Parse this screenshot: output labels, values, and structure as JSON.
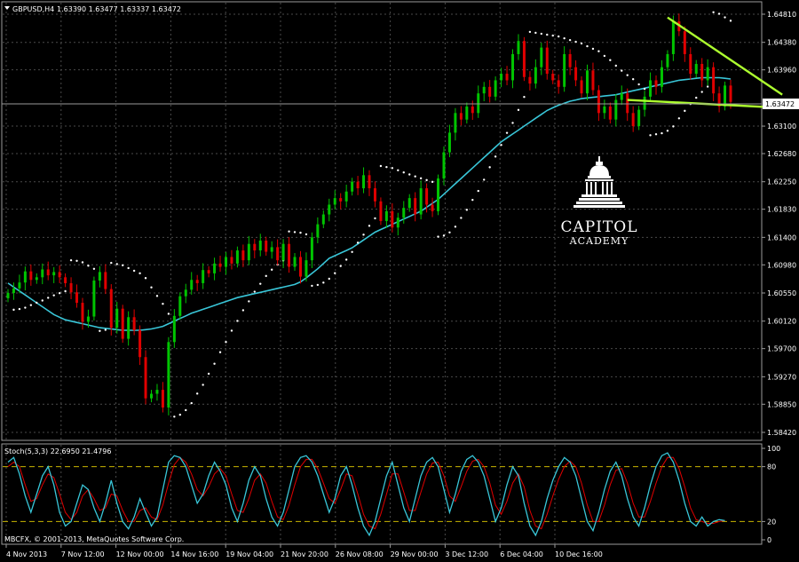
{
  "header": {
    "symbol_text": "GBPUSD,H4",
    "ohlc_text": "1.63390 1.63477 1.63337 1.63472"
  },
  "current_price_label": "1.63472",
  "stoch_label": "Stoch(5,3,3) 22.6950 21.4796",
  "copyright": "MBCFX, © 2001-2013, MetaQuotes Software Corp.",
  "logo": {
    "line1": "CAPITOL",
    "line2": "ACADEMY"
  },
  "colors": {
    "background": "#000000",
    "grid": "#4a4a4a",
    "bull": "#00c400",
    "bear": "#e00000",
    "ma": "#39c6d8",
    "sar": "#ffffff",
    "trendline": "#adff2f",
    "stoch_main": "#39c6d8",
    "stoch_signal": "#e00000",
    "stoch_level": "#c8b400"
  },
  "chart_data": [
    {
      "type": "candlestick",
      "symbol": "GBPUSD",
      "timeframe": "H4",
      "y_ticks": [
        "1.64810",
        "1.64380",
        "1.63960",
        "1.63100",
        "1.62680",
        "1.62250",
        "1.61830",
        "1.61400",
        "1.60980",
        "1.60550",
        "1.60120",
        "1.59700",
        "1.59270",
        "1.58850",
        "1.58420"
      ],
      "x_ticks": [
        "4 Nov 2013",
        "7 Nov 12:00",
        "12 Nov 00:00",
        "14 Nov 16:00",
        "19 Nov 04:00",
        "21 Nov 20:00",
        "26 Nov 08:00",
        "29 Nov 00:00",
        "3 Dec 12:00",
        "6 Dec 04:00",
        "10 Dec 16:00"
      ],
      "ylim": [
        1.5842,
        1.6481
      ],
      "last_price": 1.63472,
      "close": [
        1.6055,
        1.6062,
        1.6071,
        1.6088,
        1.6075,
        1.6079,
        1.6091,
        1.6082,
        1.6087,
        1.6079,
        1.607,
        1.6056,
        1.604,
        1.6011,
        1.6019,
        1.6074,
        1.6087,
        1.6061,
        1.6002,
        1.6031,
        1.5985,
        1.6018,
        1.5998,
        1.5957,
        1.5894,
        1.5901,
        1.5907,
        1.588,
        1.598,
        1.602,
        1.605,
        1.606,
        1.6075,
        1.607,
        1.609,
        1.6085,
        1.61,
        1.6095,
        1.611,
        1.61,
        1.612,
        1.6105,
        1.613,
        1.612,
        1.6135,
        1.6118,
        1.6125,
        1.6105,
        1.613,
        1.6095,
        1.611,
        1.608,
        1.6105,
        1.614,
        1.616,
        1.6175,
        1.619,
        1.62,
        1.6195,
        1.621,
        1.6225,
        1.6215,
        1.6235,
        1.6215,
        1.6195,
        1.6165,
        1.618,
        1.6155,
        1.617,
        1.6185,
        1.62,
        1.6175,
        1.6215,
        1.619,
        1.618,
        1.623,
        1.627,
        1.63,
        1.633,
        1.632,
        1.634,
        1.633,
        1.636,
        1.637,
        1.6355,
        1.638,
        1.639,
        1.638,
        1.642,
        1.644,
        1.6385,
        1.6375,
        1.64,
        1.643,
        1.639,
        1.638,
        1.637,
        1.642,
        1.64,
        1.638,
        1.636,
        1.6395,
        1.6365,
        1.633,
        1.634,
        1.632,
        1.635,
        1.636,
        1.633,
        1.631,
        1.6335,
        1.6355,
        1.638,
        1.637,
        1.64,
        1.642,
        1.647,
        1.6455,
        1.642,
        1.639,
        1.6405,
        1.638,
        1.64,
        1.636,
        1.634,
        1.6372,
        1.6347
      ],
      "sma": [
        1.607,
        1.6064,
        1.6058,
        1.6052,
        1.6046,
        1.604,
        1.6034,
        1.6028,
        1.6022,
        1.6018,
        1.6014,
        1.6012,
        1.601,
        1.6008,
        1.6006,
        1.6004,
        1.6002,
        1.6001,
        1.6,
        1.5999,
        1.5998,
        1.5998,
        1.5998,
        1.5998,
        1.5999,
        1.6,
        1.6002,
        1.6004,
        1.6008,
        1.6012,
        1.6016,
        1.602,
        1.6024,
        1.6027,
        1.603,
        1.6033,
        1.6036,
        1.6039,
        1.6042,
        1.6045,
        1.6048,
        1.605,
        1.6052,
        1.6054,
        1.6056,
        1.6058,
        1.606,
        1.6062,
        1.6064,
        1.6066,
        1.6068,
        1.6072,
        1.6078,
        1.6085,
        1.6092,
        1.61,
        1.6108,
        1.6112,
        1.6116,
        1.612,
        1.6124,
        1.613,
        1.6136,
        1.6142,
        1.6148,
        1.6152,
        1.6156,
        1.616,
        1.6164,
        1.6168,
        1.6172,
        1.6176,
        1.618,
        1.6186,
        1.6192,
        1.6198,
        1.6206,
        1.6214,
        1.6222,
        1.623,
        1.6238,
        1.6246,
        1.6254,
        1.6262,
        1.627,
        1.6278,
        1.6286,
        1.6292,
        1.6298,
        1.6304,
        1.631,
        1.6316,
        1.6322,
        1.6328,
        1.6334,
        1.6338,
        1.6342,
        1.6345,
        1.6348,
        1.635,
        1.6352,
        1.6353,
        1.6354,
        1.6355,
        1.6356,
        1.6357,
        1.6358,
        1.636,
        1.6362,
        1.6364,
        1.6366,
        1.6368,
        1.637,
        1.6372,
        1.6374,
        1.6376,
        1.6378,
        1.638,
        1.6381,
        1.6382,
        1.6383,
        1.6384,
        1.6384,
        1.6384,
        1.6384,
        1.6383,
        1.6382
      ],
      "trendlines": [
        {
          "from": [
            1.6476
          ],
          "to": [
            1.6358
          ],
          "start_index": 115,
          "end_index": 135
        },
        {
          "from": [
            1.635
          ],
          "to": [
            1.6338
          ],
          "start_index": 108,
          "end_index": 135
        }
      ]
    },
    {
      "type": "line",
      "title": "Stoch(5,3,3) 22.6950 21.4796",
      "ylim": [
        0,
        100
      ],
      "y_ticks": [
        "100",
        "80",
        "20",
        "0"
      ],
      "levels": [
        80,
        20
      ],
      "series": [
        {
          "name": "main",
          "values": [
            85,
            90,
            72,
            48,
            30,
            50,
            70,
            80,
            60,
            30,
            15,
            20,
            40,
            60,
            55,
            35,
            20,
            40,
            65,
            40,
            20,
            12,
            25,
            45,
            30,
            15,
            25,
            55,
            85,
            92,
            90,
            80,
            60,
            40,
            50,
            70,
            85,
            75,
            60,
            35,
            20,
            40,
            65,
            80,
            70,
            45,
            25,
            15,
            30,
            55,
            80,
            90,
            92,
            85,
            70,
            50,
            30,
            45,
            70,
            80,
            60,
            35,
            15,
            5,
            20,
            45,
            70,
            85,
            60,
            35,
            20,
            45,
            70,
            85,
            90,
            80,
            55,
            30,
            50,
            75,
            88,
            92,
            85,
            70,
            45,
            20,
            35,
            60,
            80,
            70,
            40,
            15,
            5,
            20,
            45,
            65,
            80,
            90,
            85,
            70,
            45,
            20,
            10,
            30,
            55,
            75,
            85,
            70,
            45,
            25,
            15,
            35,
            60,
            80,
            92,
            95,
            85,
            65,
            40,
            20,
            15,
            25,
            15,
            20,
            22,
            21
          ]
        },
        {
          "name": "signal",
          "values": [
            80,
            85,
            80,
            60,
            42,
            45,
            60,
            72,
            68,
            50,
            30,
            22,
            30,
            48,
            55,
            45,
            32,
            35,
            50,
            48,
            32,
            20,
            20,
            32,
            35,
            25,
            22,
            38,
            62,
            82,
            90,
            85,
            72,
            55,
            48,
            58,
            72,
            78,
            70,
            50,
            32,
            30,
            45,
            65,
            72,
            62,
            42,
            25,
            22,
            38,
            60,
            80,
            88,
            88,
            78,
            62,
            45,
            40,
            55,
            72,
            70,
            50,
            28,
            15,
            12,
            28,
            50,
            72,
            72,
            52,
            32,
            32,
            52,
            72,
            84,
            85,
            70,
            48,
            42,
            58,
            75,
            86,
            88,
            80,
            62,
            38,
            28,
            42,
            62,
            72,
            58,
            32,
            15,
            12,
            28,
            48,
            66,
            80,
            86,
            80,
            62,
            38,
            20,
            20,
            38,
            60,
            76,
            78,
            62,
            40,
            25,
            25,
            42,
            62,
            80,
            90,
            90,
            78,
            58,
            35,
            22,
            20,
            18,
            18,
            20,
            21
          ]
        }
      ]
    }
  ]
}
